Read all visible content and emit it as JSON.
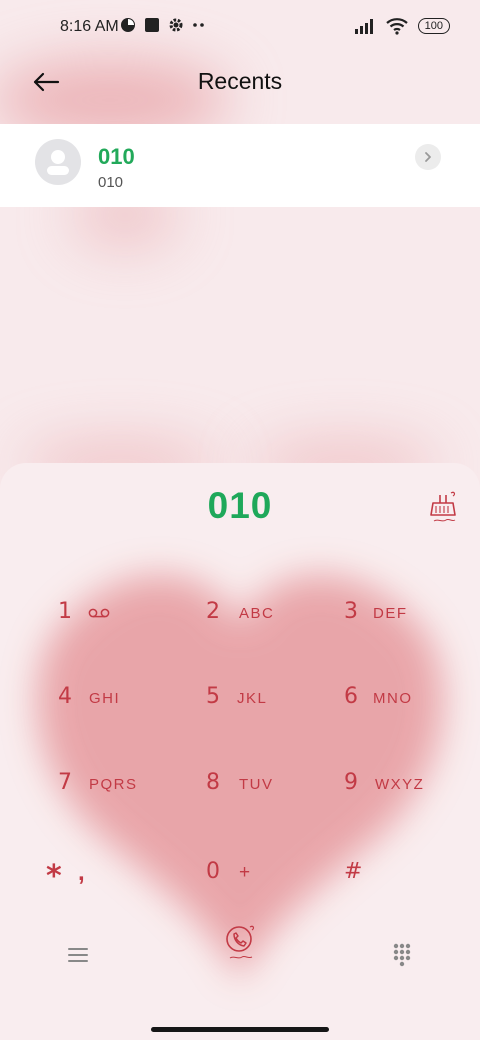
{
  "status_bar": {
    "time": "8:16 AM",
    "battery": "100"
  },
  "header": {
    "title": "Recents"
  },
  "recent_call": {
    "name": "010",
    "number": "010"
  },
  "dialer": {
    "entered_number": "010",
    "keys": [
      {
        "digit": "1",
        "letters": ""
      },
      {
        "digit": "2",
        "letters": "ABC"
      },
      {
        "digit": "3",
        "letters": "DEF"
      },
      {
        "digit": "4",
        "letters": "GHI"
      },
      {
        "digit": "5",
        "letters": "JKL"
      },
      {
        "digit": "6",
        "letters": "MNO"
      },
      {
        "digit": "7",
        "letters": "PQRS"
      },
      {
        "digit": "8",
        "letters": "TUV"
      },
      {
        "digit": "9",
        "letters": "WXYZ"
      },
      {
        "digit": "*",
        "letters": ","
      },
      {
        "digit": "0",
        "letters": "+"
      },
      {
        "digit": "#",
        "letters": ""
      }
    ]
  },
  "colors": {
    "accent_green": "#22a95a",
    "key_red": "#c23a45",
    "heart_pink": "#e79ea2"
  },
  "icons": [
    "back-arrow-icon",
    "voicemail-icon",
    "clear-broom-icon",
    "call-icon",
    "menu-icon",
    "keypad-icon",
    "chevron-right-icon",
    "person-icon"
  ]
}
